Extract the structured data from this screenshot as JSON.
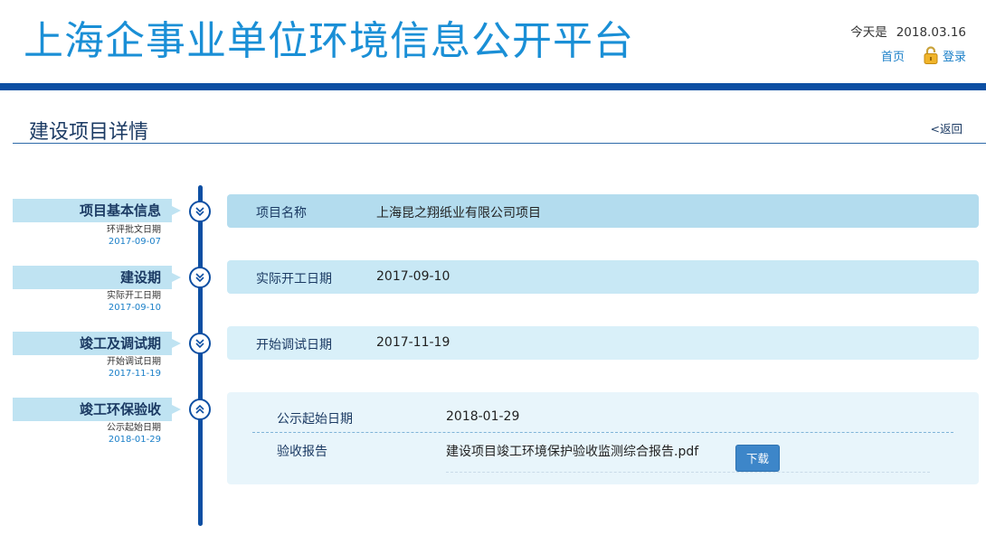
{
  "header": {
    "site_title": "上海企事业单位环境信息公开平台",
    "today_label": "今天是",
    "today_date": "2018.03.16",
    "home_link": "首页",
    "login_link": "登录",
    "brand_color": "#1a8fd6",
    "bar_color": "#0d4fa3"
  },
  "page": {
    "title": "建设项目详情",
    "back_link": "<返回"
  },
  "timeline": [
    {
      "label": "项目基本信息",
      "sub_label": "环评批文日期",
      "sub_date": "2017-09-07",
      "icon": "chevron-double-down-icon"
    },
    {
      "label": "建设期",
      "sub_label": "实际开工日期",
      "sub_date": "2017-09-10",
      "icon": "chevron-double-down-icon"
    },
    {
      "label": "竣工及调试期",
      "sub_label": "开始调试日期",
      "sub_date": "2017-11-19",
      "icon": "chevron-double-down-icon"
    },
    {
      "label": "竣工环保验收",
      "sub_label": "公示起始日期",
      "sub_date": "2018-01-29",
      "icon": "chevron-double-up-icon"
    }
  ],
  "panels": {
    "basic": {
      "label": "项目名称",
      "value": "上海昆之翔纸业有限公司项目"
    },
    "construction": {
      "label": "实际开工日期",
      "value": "2017-09-10"
    },
    "trial": {
      "label": "开始调试日期",
      "value": "2017-11-19"
    },
    "acceptance": {
      "row1_label": "公示起始日期",
      "row1_value": "2018-01-29",
      "row2_label": "验收报告",
      "row2_value": "建设项目竣工环境保护验收监测综合报告.pdf",
      "download_label": "下载"
    }
  }
}
